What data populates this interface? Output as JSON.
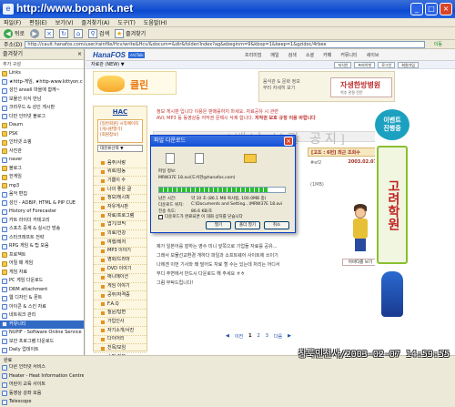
{
  "window": {
    "title": "http://www.bopank.net"
  },
  "menu": [
    "파일(F)",
    "편집(E)",
    "보기(V)",
    "즐겨찾기(A)",
    "도구(T)",
    "도움말(H)"
  ],
  "toolbar": {
    "back": "뒤로",
    "search": "검색",
    "favorites": "즐겨찾기"
  },
  "address": {
    "label": "주소(D)",
    "url": "http://cauit.hanafos.com/user/rainfile/Hcv/write&Hcv/&docum=&dir&folder/Index?ag&ebeginm=9&kbop=1&keep=1&gzidoc/4rbee",
    "go": "이동"
  },
  "favorites": {
    "header": "즐겨찾기",
    "tools": "추가  구성",
    "items": [
      {
        "label": "Links",
        "type": "folder"
      },
      {
        "label": "★http-게임, ★http-www.kittyon.c",
        "type": "page"
      },
      {
        "label": "성인 ansell 마을에 함께~",
        "type": "page"
      },
      {
        "label": "보물선 이식 만남",
        "type": "page"
      },
      {
        "label": "크라우드 & 성인 게시판",
        "type": "page"
      },
      {
        "label": "다만 인터넷 블로그",
        "type": "page"
      },
      {
        "label": "Daum",
        "type": "folder"
      },
      {
        "label": "PSK",
        "type": "folder"
      },
      {
        "label": "인터넷 쇼핑",
        "type": "folder"
      },
      {
        "label": "사진관",
        "type": "folder"
      },
      {
        "label": "naver",
        "type": "page"
      },
      {
        "label": "블로그",
        "type": "folder"
      },
      {
        "label": "한게임",
        "type": "folder"
      },
      {
        "label": "mp3",
        "type": "folder"
      },
      {
        "label": "음악 편집",
        "type": "page"
      },
      {
        "label": "성인 - ADBIP, HTML & PIP CUE",
        "type": "page"
      },
      {
        "label": "History of Forecaster",
        "type": "page"
      },
      {
        "label": "카트 라이더 카테고리",
        "type": "page"
      },
      {
        "label": "스포츠 중계 & 실시간 방송",
        "type": "page"
      },
      {
        "label": "스타크래프트 전략",
        "type": "page"
      },
      {
        "label": "RPG 게임 & 팁 모음",
        "type": "page"
      },
      {
        "label": "프로젝트",
        "type": "folder"
      },
      {
        "label": "어릴 때 게임",
        "type": "folder"
      },
      {
        "label": "게임 자료",
        "type": "folder"
      },
      {
        "label": "PC 게임 다운로드",
        "type": "page"
      },
      {
        "label": "DRM attachment",
        "type": "page"
      },
      {
        "label": "웹 디자인 & 폰트",
        "type": "page"
      },
      {
        "label": "아이콘 & 스킨 자료",
        "type": "page"
      },
      {
        "label": "네트워크 관리",
        "type": "page"
      },
      {
        "label": "커뮤니티",
        "type": "selected"
      },
      {
        "label": "NUPIF - Software Online Service",
        "type": "page"
      },
      {
        "label": "보안 프로그램 다운로드",
        "type": "page"
      },
      {
        "label": "Daily 업데이트",
        "type": "page"
      },
      {
        "label": "바이러스 & 스파이웨어",
        "type": "page"
      },
      {
        "label": "다른 인터넷 서비스",
        "type": "page"
      },
      {
        "label": "Heater - Heat Information Centre",
        "type": "page"
      },
      {
        "label": "어린이 교육 사이트",
        "type": "page"
      },
      {
        "label": "동영상 강좌 모음",
        "type": "page"
      },
      {
        "label": "Telescope",
        "type": "page"
      }
    ]
  },
  "site": {
    "logo": "HanaFOS",
    "badge": "스타Talk",
    "nav": [
      "프리미엄",
      "메일",
      "검색",
      "소셜",
      "카페",
      "커뮤니티",
      "세이브"
    ],
    "subbar": "자료관 (NEW) ▼",
    "search_buttons": [
      "지식인",
      "프라이빗",
      "로그인",
      "회원가입"
    ],
    "banner1": "클린",
    "banner2": {
      "left": "음식관 & 문화 정보\n부터 자세히 보기",
      "title": "자생한방병원",
      "sub": "척추 관절 전문"
    },
    "leftnav": {
      "title": "HAC",
      "login": "[일반회원] 시작페이지\n[게시판열기]\n[회원정보]",
      "select": "대분류선택 ▼",
      "items": [
        "음주/사랑",
        "위로/감동",
        "기쁨이 수",
        "나의 좋은 글",
        "정보/레시피",
        "자유게시판",
        "자료/프로그램",
        "엽기/코믹",
        "의료/건강",
        "여행/레저",
        "MP3 이야기",
        "영화/드라마",
        "DVD 이야기",
        "애니메이션",
        "게임 이야기",
        "공부/자격증",
        "F.A.Q",
        "질문/답변",
        "가입인사",
        "자기소개/사진",
        "다이어리",
        "친목/모임",
        "쇼핑 정보",
        "스포츠",
        "기타"
      ]
    },
    "notice": "정보 게시판 입니다 이용은 판매를하지 마세요. 자료공유 시 관련\nAVI, MP3 등 동영상등 저작권 문제시 삭제 합니다.",
    "notice_link": "저작권 보호 규정 이용 바랍니다",
    "big_title": "[배너 보관 공지]",
    "board_head": "[고조 : 6번]  최근 조회수",
    "board_date": "2003.02.07",
    "board_sub": "#ef2",
    "board_sub2": "(1MB)",
    "body": [
      "제가 일본어를 잘하는 영수 미니 앞쪽으로 기업들 자료를 공유...",
      "그래서 보물선교환경 개하다 파일과 소프트웨어 사이트에 쓰이기",
      "나에겐 이번 기사와 왜 밀어도 자료 할 수는 있는데 처리는 어디서",
      "부디 주변에서 반드시 다운로드 해 주세요 ㅎㅎ",
      "그럼 부탁드립니다!"
    ],
    "character_caption": "아바타를 보기",
    "pager": [
      "◀",
      "이전",
      "1",
      "2",
      "3",
      "다음",
      "▶"
    ],
    "right_ad": {
      "top": "이벤트\n진행중",
      "mid": "고려학원",
      "label": "댓글"
    }
  },
  "dialog": {
    "title": "파일 다운로드",
    "label_file": "파일 정보:",
    "file_name": "MRW37E 18.avi(도서관@hanafos.com)",
    "label_eta": "남은 시간:",
    "eta": "약 10 초 (86.1 MB 복사됨, 100.0MB 중)",
    "label_dest": "다운로드 위치:",
    "dest": "C:\\Documents and Setting...\\MRW37E 18.avi",
    "label_rate": "전송 속도:",
    "rate": "86.6 KB/초",
    "progress": 0.86,
    "checkbox": "다운로드가 완료되면 이 대화 상자를 닫습니다",
    "buttons": [
      "열기",
      "폴더 열기",
      "취소"
    ]
  },
  "statusbar": "완료",
  "watermark": "창룩인천사/2003-02-07 14:59:55"
}
